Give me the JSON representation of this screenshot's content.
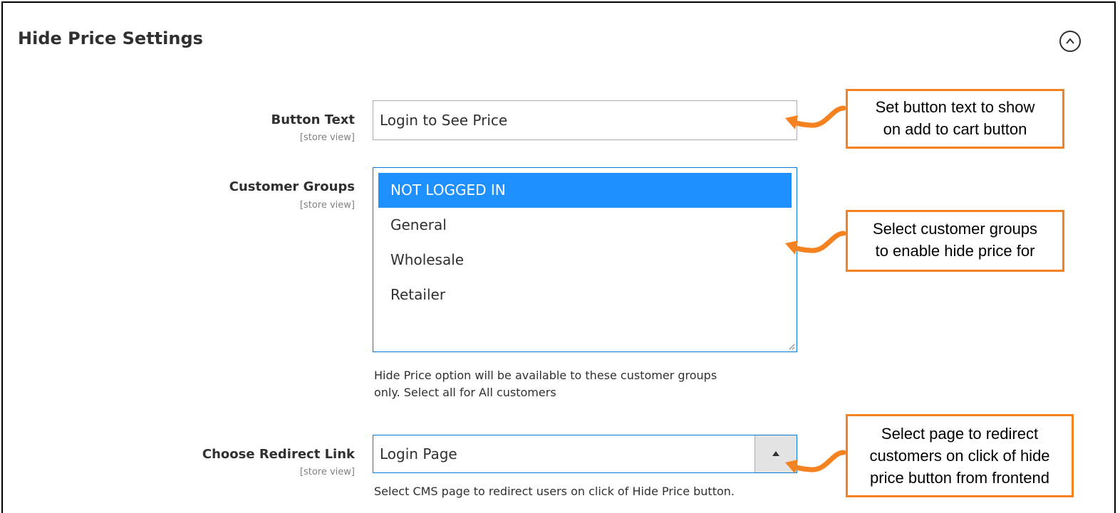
{
  "section": {
    "title": "Hide Price Settings"
  },
  "fields": {
    "button_text": {
      "label": "Button Text",
      "scope": "[store view]",
      "value": "Login to See Price"
    },
    "customer_groups": {
      "label": "Customer Groups",
      "scope": "[store view]",
      "options": [
        {
          "label": "NOT LOGGED IN",
          "selected": true
        },
        {
          "label": "General",
          "selected": false
        },
        {
          "label": "Wholesale",
          "selected": false
        },
        {
          "label": "Retailer",
          "selected": false
        }
      ],
      "note_line1": "Hide Price option will be available to these customer groups",
      "note_line2": "only. Select all for All customers"
    },
    "redirect_link": {
      "label": "Choose Redirect Link",
      "scope": "[store view]",
      "value": "Login Page",
      "note": "Select CMS page to redirect users on click of Hide Price button."
    }
  },
  "callouts": {
    "button_text": [
      "Set button text to show",
      "on add to cart button"
    ],
    "customer_groups": [
      "Select customer groups",
      "to enable hide price for"
    ],
    "redirect_link": [
      "Select page to redirect",
      "customers on click of hide",
      "price button from frontend"
    ]
  },
  "icons": {
    "collapse": "chevron-up-circle-icon",
    "select_arrow": "triangle-up-icon",
    "resize": "resize-grip-icon",
    "callout_arrow": "curved-arrow-left-icon"
  },
  "colors": {
    "callout_border": "#f58220",
    "selected_option": "#1e90ff",
    "focus_border": "#007bdb",
    "text": "#303030"
  }
}
